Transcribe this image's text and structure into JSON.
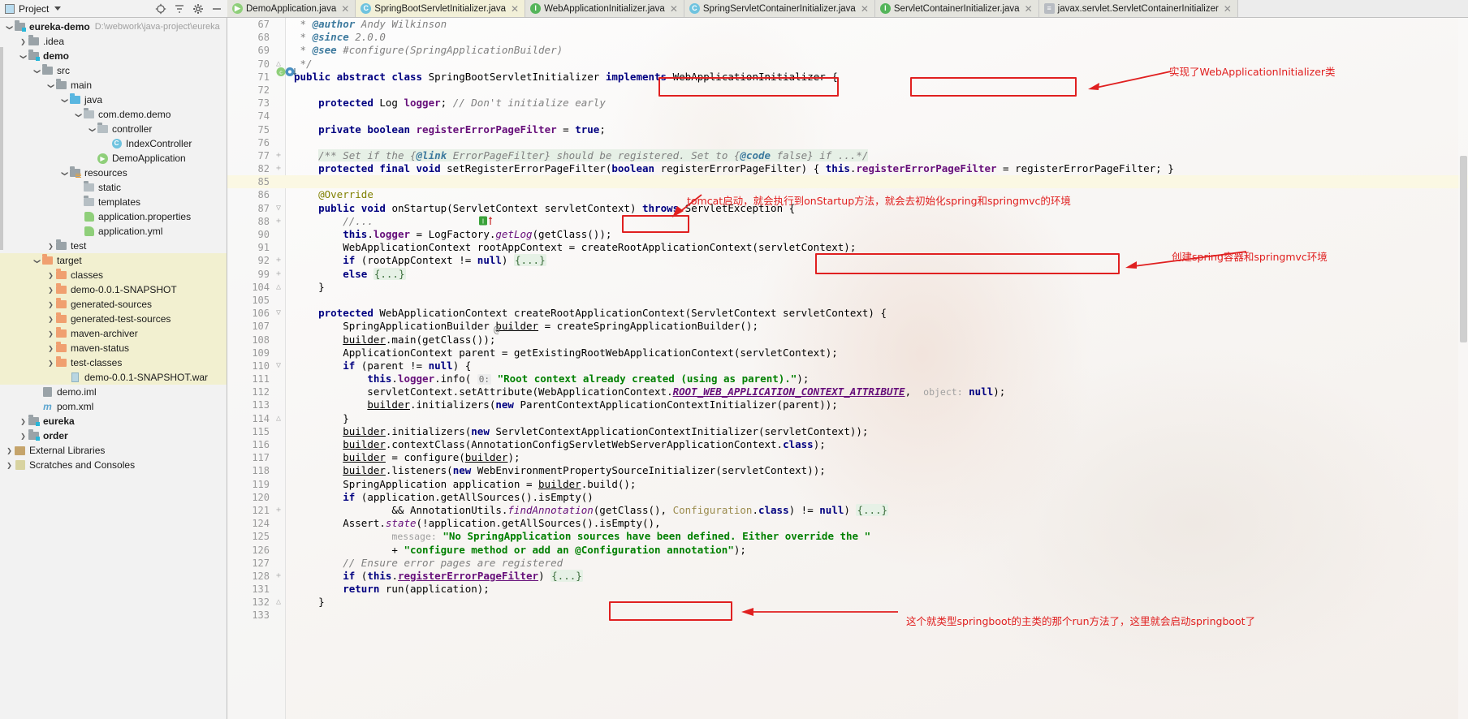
{
  "window": {
    "project_panel_title": "Project",
    "project_root": "eureka-demo",
    "project_path": "D:\\webwork\\java-project\\eureka"
  },
  "toolbar_icons": [
    {
      "name": "locate-icon",
      "glyph": "⊕"
    },
    {
      "name": "collapse-all-icon",
      "glyph": "≡"
    },
    {
      "name": "settings-gear-icon",
      "glyph": "⚙"
    },
    {
      "name": "hide-panel-icon",
      "glyph": "—"
    }
  ],
  "tree": [
    {
      "label": "eureka-demo",
      "path": "D:\\webwork\\java-project\\eureka",
      "indent": 0,
      "arrow": "down",
      "icon": "module-folder",
      "bold": true,
      "highlight": false
    },
    {
      "label": ".idea",
      "path": "",
      "indent": 1,
      "arrow": "right",
      "icon": "folder",
      "bold": false,
      "highlight": false
    },
    {
      "label": "demo",
      "path": "",
      "indent": 1,
      "arrow": "down",
      "icon": "module-folder",
      "bold": true,
      "highlight": false
    },
    {
      "label": "src",
      "path": "",
      "indent": 2,
      "arrow": "down",
      "icon": "folder",
      "bold": false,
      "highlight": false
    },
    {
      "label": "main",
      "path": "",
      "indent": 3,
      "arrow": "down",
      "icon": "folder",
      "bold": false,
      "highlight": false
    },
    {
      "label": "java",
      "path": "",
      "indent": 4,
      "arrow": "down",
      "icon": "source-folder",
      "bold": false,
      "highlight": false
    },
    {
      "label": "com.demo.demo",
      "path": "",
      "indent": 5,
      "arrow": "down",
      "icon": "package",
      "bold": false,
      "highlight": false
    },
    {
      "label": "controller",
      "path": "",
      "indent": 6,
      "arrow": "down",
      "icon": "package",
      "bold": false,
      "highlight": false
    },
    {
      "label": "IndexController",
      "path": "",
      "indent": 7,
      "arrow": "none",
      "icon": "class",
      "bold": false,
      "highlight": false
    },
    {
      "label": "DemoApplication",
      "path": "",
      "indent": 6,
      "arrow": "none",
      "icon": "spring-class",
      "bold": false,
      "highlight": false
    },
    {
      "label": "resources",
      "path": "",
      "indent": 4,
      "arrow": "down",
      "icon": "resource-folder",
      "bold": false,
      "highlight": false
    },
    {
      "label": "static",
      "path": "",
      "indent": 5,
      "arrow": "none",
      "icon": "package",
      "bold": false,
      "highlight": false
    },
    {
      "label": "templates",
      "path": "",
      "indent": 5,
      "arrow": "none",
      "icon": "package",
      "bold": false,
      "highlight": false
    },
    {
      "label": "application.properties",
      "path": "",
      "indent": 5,
      "arrow": "none",
      "icon": "spring-leaf",
      "bold": false,
      "highlight": false
    },
    {
      "label": "application.yml",
      "path": "",
      "indent": 5,
      "arrow": "none",
      "icon": "spring-leaf",
      "bold": false,
      "highlight": false
    },
    {
      "label": "test",
      "path": "",
      "indent": 3,
      "arrow": "right",
      "icon": "folder",
      "bold": false,
      "highlight": false
    },
    {
      "label": "target",
      "path": "",
      "indent": 2,
      "arrow": "down",
      "icon": "excluded-folder",
      "bold": false,
      "highlight": true
    },
    {
      "label": "classes",
      "path": "",
      "indent": 3,
      "arrow": "right",
      "icon": "excluded-folder",
      "bold": false,
      "highlight": true
    },
    {
      "label": "demo-0.0.1-SNAPSHOT",
      "path": "",
      "indent": 3,
      "arrow": "right",
      "icon": "excluded-folder",
      "bold": false,
      "highlight": true
    },
    {
      "label": "generated-sources",
      "path": "",
      "indent": 3,
      "arrow": "right",
      "icon": "excluded-folder",
      "bold": false,
      "highlight": true
    },
    {
      "label": "generated-test-sources",
      "path": "",
      "indent": 3,
      "arrow": "right",
      "icon": "excluded-folder",
      "bold": false,
      "highlight": true
    },
    {
      "label": "maven-archiver",
      "path": "",
      "indent": 3,
      "arrow": "right",
      "icon": "excluded-folder",
      "bold": false,
      "highlight": true
    },
    {
      "label": "maven-status",
      "path": "",
      "indent": 3,
      "arrow": "right",
      "icon": "excluded-folder",
      "bold": false,
      "highlight": true
    },
    {
      "label": "test-classes",
      "path": "",
      "indent": 3,
      "arrow": "right",
      "icon": "excluded-folder",
      "bold": false,
      "highlight": true
    },
    {
      "label": "demo-0.0.1-SNAPSHOT.war",
      "path": "",
      "indent": 4,
      "arrow": "none",
      "icon": "war",
      "bold": false,
      "highlight": true
    },
    {
      "label": "demo.iml",
      "path": "",
      "indent": 2,
      "arrow": "none",
      "icon": "iml",
      "bold": false,
      "highlight": false
    },
    {
      "label": "pom.xml",
      "path": "",
      "indent": 2,
      "arrow": "none",
      "icon": "maven",
      "bold": false,
      "highlight": false
    },
    {
      "label": "eureka",
      "path": "",
      "indent": 1,
      "arrow": "right",
      "icon": "module-folder",
      "bold": true,
      "highlight": false
    },
    {
      "label": "order",
      "path": "",
      "indent": 1,
      "arrow": "right",
      "icon": "module-folder",
      "bold": true,
      "highlight": false
    },
    {
      "label": "External Libraries",
      "path": "",
      "indent": 0,
      "arrow": "right",
      "icon": "library",
      "bold": false,
      "highlight": false
    },
    {
      "label": "Scratches and Consoles",
      "path": "",
      "indent": 0,
      "arrow": "right",
      "icon": "scratch",
      "bold": false,
      "highlight": false
    }
  ],
  "tabs": [
    {
      "label": "DemoApplication.java",
      "icon": "spring-class-icon",
      "icon_kind": "g",
      "active": false
    },
    {
      "label": "SpringBootServletInitializer.java",
      "icon": "class-icon",
      "icon_kind": "c",
      "active": true
    },
    {
      "label": "WebApplicationInitializer.java",
      "icon": "interface-icon",
      "icon_kind": "i",
      "active": false
    },
    {
      "label": "SpringServletContainerInitializer.java",
      "icon": "class-icon",
      "icon_kind": "c",
      "active": false
    },
    {
      "label": "ServletContainerInitializer.java",
      "icon": "interface-icon",
      "icon_kind": "i",
      "active": false
    },
    {
      "label": "javax.servlet.ServletContainerInitializer",
      "icon": "file-icon",
      "icon_kind": "f",
      "active": false
    }
  ],
  "editor": {
    "current_line": 85,
    "lines": [
      {
        "num": "67",
        "fold": "",
        "cur": false
      },
      {
        "num": "68",
        "fold": "",
        "cur": false
      },
      {
        "num": "69",
        "fold": "",
        "cur": false
      },
      {
        "num": "70",
        "fold": "△",
        "cur": false
      },
      {
        "num": "71",
        "fold": "",
        "cur": false
      },
      {
        "num": "72",
        "fold": "",
        "cur": false
      },
      {
        "num": "73",
        "fold": "",
        "cur": false
      },
      {
        "num": "74",
        "fold": "",
        "cur": false
      },
      {
        "num": "75",
        "fold": "",
        "cur": false
      },
      {
        "num": "76",
        "fold": "",
        "cur": false
      },
      {
        "num": "77",
        "fold": "+",
        "cur": false
      },
      {
        "num": "82",
        "fold": "+",
        "cur": false
      },
      {
        "num": "85",
        "fold": "",
        "cur": true
      },
      {
        "num": "86",
        "fold": "",
        "cur": false
      },
      {
        "num": "87",
        "fold": "▽",
        "cur": false
      },
      {
        "num": "88",
        "fold": "+",
        "cur": false
      },
      {
        "num": "90",
        "fold": "",
        "cur": false
      },
      {
        "num": "91",
        "fold": "",
        "cur": false
      },
      {
        "num": "92",
        "fold": "+",
        "cur": false
      },
      {
        "num": "99",
        "fold": "+",
        "cur": false
      },
      {
        "num": "104",
        "fold": "△",
        "cur": false
      },
      {
        "num": "105",
        "fold": "",
        "cur": false
      },
      {
        "num": "106",
        "fold": "▽",
        "cur": false
      },
      {
        "num": "107",
        "fold": "",
        "cur": false
      },
      {
        "num": "108",
        "fold": "",
        "cur": false
      },
      {
        "num": "109",
        "fold": "",
        "cur": false
      },
      {
        "num": "110",
        "fold": "▽",
        "cur": false
      },
      {
        "num": "111",
        "fold": "",
        "cur": false
      },
      {
        "num": "112",
        "fold": "",
        "cur": false
      },
      {
        "num": "113",
        "fold": "",
        "cur": false
      },
      {
        "num": "114",
        "fold": "△",
        "cur": false
      },
      {
        "num": "115",
        "fold": "",
        "cur": false
      },
      {
        "num": "116",
        "fold": "",
        "cur": false
      },
      {
        "num": "117",
        "fold": "",
        "cur": false
      },
      {
        "num": "118",
        "fold": "",
        "cur": false
      },
      {
        "num": "119",
        "fold": "",
        "cur": false
      },
      {
        "num": "120",
        "fold": "",
        "cur": false
      },
      {
        "num": "121",
        "fold": "+",
        "cur": false
      },
      {
        "num": "124",
        "fold": "",
        "cur": false
      },
      {
        "num": "125",
        "fold": "",
        "cur": false
      },
      {
        "num": "126",
        "fold": "",
        "cur": false
      },
      {
        "num": "127",
        "fold": "",
        "cur": false
      },
      {
        "num": "128",
        "fold": "+",
        "cur": false
      },
      {
        "num": "131",
        "fold": "",
        "cur": false
      },
      {
        "num": "132",
        "fold": "△",
        "cur": false
      },
      {
        "num": "133",
        "fold": "",
        "cur": false
      }
    ],
    "gutter_marks": {
      "line71": "class-override-marker",
      "line87": "implementing-method-marker",
      "line106": "annotation-marker"
    }
  },
  "annotations": [
    {
      "id": "a1",
      "text": "实现了WebApplicationInitializer类"
    },
    {
      "id": "a2",
      "text": "tomcat启动，就会执行到onStartup方法，就会去初始化spring和springmvc的环境"
    },
    {
      "id": "a3",
      "text": "创建spring容器和springmvc环境"
    },
    {
      "id": "a4",
      "text": "这个就类型springboot的主类的那个run方法了，这里就会启动springboot了"
    }
  ],
  "highlight_boxes": [
    {
      "name": "springbootservletinitializer-box",
      "target": "SpringBootServletInitializer"
    },
    {
      "name": "webapplicationinitializer-box",
      "target": "WebApplicationInitializer"
    },
    {
      "name": "onstartup-box",
      "target": "onStartup("
    },
    {
      "name": "createrootapplicationcontext-box",
      "target": "createRootApplicationContext(servletContext);"
    },
    {
      "name": "run-application-box",
      "target": "run(application);"
    }
  ],
  "colors": {
    "annotation_red": "#e02020",
    "keyword_blue": "#000080",
    "string_green": "#008000",
    "comment_gray": "#808080",
    "field_purple": "#660e7a",
    "tab_active_bg": "#f2f0d8",
    "tree_highlight": "#f2f0d0"
  }
}
